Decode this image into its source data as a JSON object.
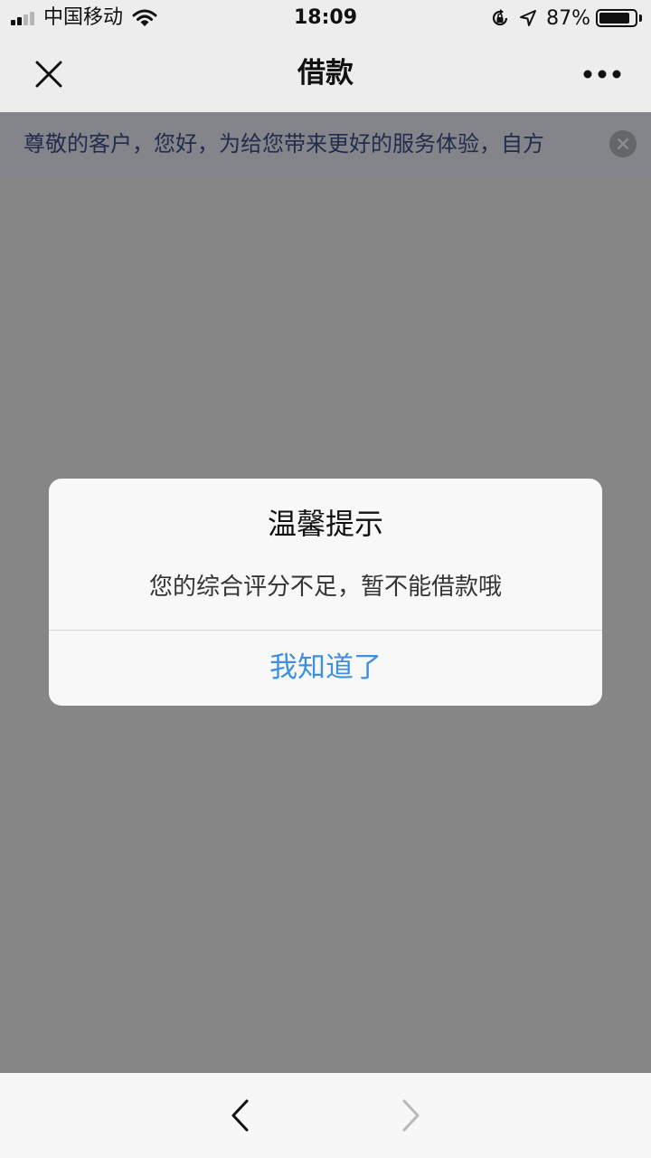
{
  "status_bar": {
    "carrier": "中国移动",
    "time": "18:09",
    "battery_percent": "87%",
    "battery_level": 0.87,
    "signal_bars_filled": 2,
    "signal_bars_total": 4,
    "icons": [
      "signal-icon",
      "wifi-icon",
      "rotation-lock-icon",
      "location-arrow-icon",
      "battery-icon"
    ]
  },
  "nav": {
    "title": "借款",
    "close_icon": "close-icon",
    "more_icon": "more-dots-icon"
  },
  "notice": {
    "text": "尊敬的客户，您好，为给您带来更好的服务体验，自方",
    "close_icon": "circle-close-icon"
  },
  "dialog": {
    "title": "温馨提示",
    "message": "您的综合评分不足，暂不能借款哦",
    "confirm_label": "我知道了"
  },
  "toolbar": {
    "back_icon": "chevron-left-icon",
    "forward_icon": "chevron-right-icon",
    "forward_enabled": false
  },
  "colors": {
    "accent": "#3d8fe0",
    "nav_background": "#ededed",
    "notice_text": "#40508a",
    "mask": "rgba(0,0,0,0.45)"
  }
}
